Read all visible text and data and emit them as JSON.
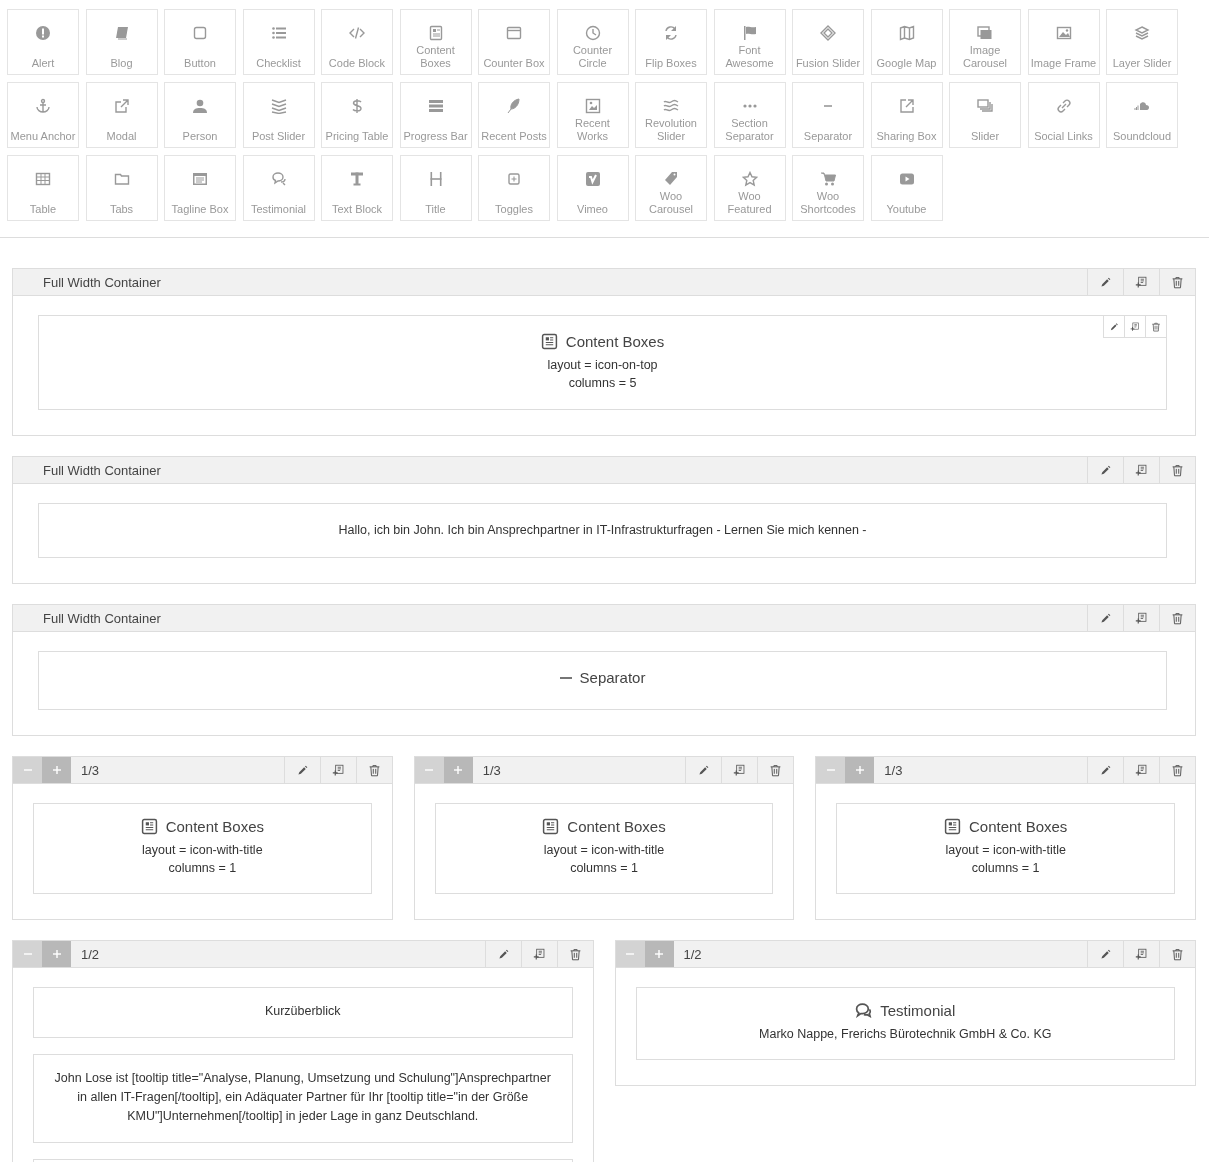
{
  "palette": [
    {
      "label": "Alert"
    },
    {
      "label": "Blog"
    },
    {
      "label": "Button"
    },
    {
      "label": "Checklist"
    },
    {
      "label": "Code Block"
    },
    {
      "label": "Content Boxes"
    },
    {
      "label": "Counter Box"
    },
    {
      "label": "Counter Circle"
    },
    {
      "label": "Flip Boxes"
    },
    {
      "label": "Font Awesome"
    },
    {
      "label": "Fusion Slider"
    },
    {
      "label": "Google Map"
    },
    {
      "label": "Image Carousel"
    },
    {
      "label": "Image Frame"
    },
    {
      "label": "Layer Slider"
    },
    {
      "label": "Menu Anchor"
    },
    {
      "label": "Modal"
    },
    {
      "label": "Person"
    },
    {
      "label": "Post Slider"
    },
    {
      "label": "Pricing Table"
    },
    {
      "label": "Progress Bar"
    },
    {
      "label": "Recent Posts"
    },
    {
      "label": "Recent Works"
    },
    {
      "label": "Revolution Slider"
    },
    {
      "label": "Section Separator"
    },
    {
      "label": "Separator"
    },
    {
      "label": "Sharing Box"
    },
    {
      "label": "Slider"
    },
    {
      "label": "Social Links"
    },
    {
      "label": "Soundcloud"
    },
    {
      "label": "Table"
    },
    {
      "label": "Tabs"
    },
    {
      "label": "Tagline Box"
    },
    {
      "label": "Testimonial"
    },
    {
      "label": "Text Block"
    },
    {
      "label": "Title"
    },
    {
      "label": "Toggles"
    },
    {
      "label": "Vimeo"
    },
    {
      "label": "Woo Carousel"
    },
    {
      "label": "Woo Featured"
    },
    {
      "label": "Woo Shortcodes"
    },
    {
      "label": "Youtube"
    }
  ],
  "rows": [
    {
      "kind": "full",
      "title": "Full Width Container",
      "elements": [
        {
          "kind": "content-boxes",
          "title": "Content Boxes",
          "lines": [
            "layout = icon-on-top",
            "columns = 5"
          ],
          "tools": true
        }
      ]
    },
    {
      "kind": "full",
      "title": "Full Width Container",
      "elements": [
        {
          "kind": "text",
          "text": "Hallo, ich bin John. Ich bin Ansprechpartner in IT-Infrastrukturfragen - Lernen Sie mich kennen -"
        }
      ]
    },
    {
      "kind": "full",
      "title": "Full Width Container",
      "elements": [
        {
          "kind": "separator",
          "title": "Separator"
        }
      ]
    },
    {
      "kind": "columns",
      "columns": [
        {
          "label": "1/3",
          "elements": [
            {
              "kind": "content-boxes",
              "title": "Content Boxes",
              "lines": [
                "layout = icon-with-title",
                "columns = 1"
              ]
            }
          ]
        },
        {
          "label": "1/3",
          "elements": [
            {
              "kind": "content-boxes",
              "title": "Content Boxes",
              "lines": [
                "layout = icon-with-title",
                "columns = 1"
              ]
            }
          ]
        },
        {
          "label": "1/3",
          "elements": [
            {
              "kind": "content-boxes",
              "title": "Content Boxes",
              "lines": [
                "layout = icon-with-title",
                "columns = 1"
              ]
            }
          ]
        }
      ]
    },
    {
      "kind": "columns",
      "columns": [
        {
          "label": "1/2",
          "elements": [
            {
              "kind": "text",
              "text": "Kurzüberblick"
            },
            {
              "kind": "text",
              "text": "John Lose ist [tooltip title=\"Analyse, Planung, Umsetzung und Schulung\"]Ansprechpartner in allen IT-Fragen[/tooltip], ein Adäquater Partner für Ihr [tooltip title=\"in der Größe KMU\"]Unternehmen[/tooltip] in jeder Lage in ganz Deutschland."
            },
            {
              "kind": "blank"
            }
          ]
        },
        {
          "label": "1/2",
          "elements": [
            {
              "kind": "testimonial",
              "title": "Testimonial",
              "lines": [
                "Marko Nappe, Frerichs Bürotechnik GmbH & Co. KG"
              ]
            }
          ]
        }
      ]
    }
  ]
}
